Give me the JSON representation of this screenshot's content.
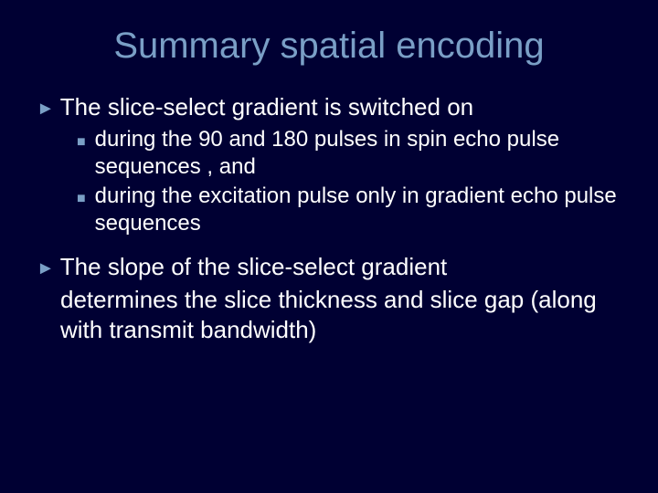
{
  "title": "Summary spatial encoding",
  "bullets": {
    "b1": "The slice-select gradient is switched on",
    "b1_sub1": "during the 90 and 180 pulses in spin echo pulse sequences , and",
    "b1_sub2": "during the excitation pulse only in gradient echo pulse sequences",
    "b2_line1": "The slope of the slice-select gradient",
    "b2_line2": "determines the slice thickness and slice gap (along with transmit bandwidth)"
  }
}
